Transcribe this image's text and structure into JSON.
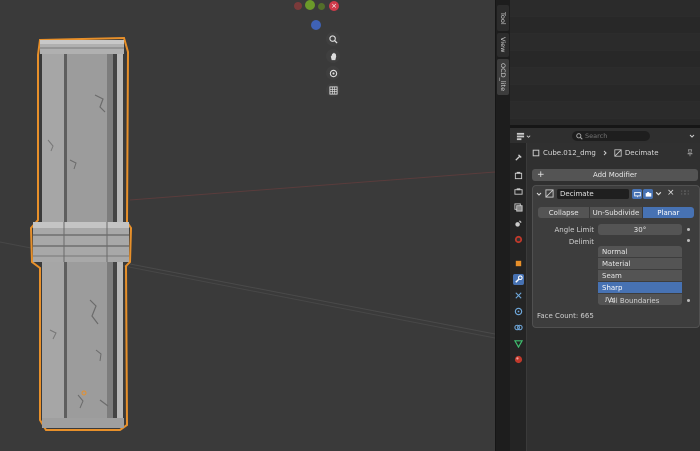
{
  "sidebar_tabs": [
    {
      "label": "Tool"
    },
    {
      "label": "View"
    },
    {
      "label": "OCD_lite"
    }
  ],
  "properties": {
    "search_placeholder": "Search",
    "breadcrumb_object": "Cube.012_dmg",
    "breadcrumb_modifier": "Decimate",
    "add_modifier_label": "Add Modifier"
  },
  "modifier": {
    "name": "Decimate",
    "modes": [
      "Collapse",
      "Un-Subdivide",
      "Planar"
    ],
    "active_mode": "Planar",
    "angle_limit_label": "Angle Limit",
    "angle_limit_value": "30°",
    "delimit_label": "Delimit",
    "delimit_options": [
      "Normal",
      "Material",
      "Seam",
      "Sharp",
      "UVs"
    ],
    "delimit_active": "Sharp",
    "all_boundaries_label": "All Boundaries",
    "face_count_label": "Face Count: 665"
  },
  "colors": {
    "accent": "#4772b3",
    "selection_outline": "#e8902a",
    "viewport_bg": "#3a3a3a"
  }
}
